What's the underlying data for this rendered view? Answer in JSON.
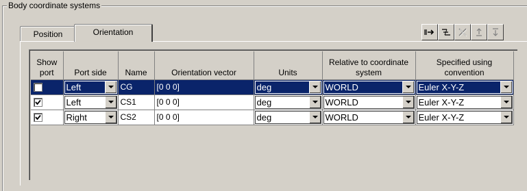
{
  "group": {
    "title": "Body coordinate systems"
  },
  "tabs": [
    {
      "label": "Position",
      "active": false
    },
    {
      "label": "Orientation",
      "active": true
    }
  ],
  "toolbar": {
    "buttons": [
      {
        "name": "add-icon",
        "enabled": true
      },
      {
        "name": "indent-icon",
        "enabled": true
      },
      {
        "name": "delete-icon",
        "enabled": false
      },
      {
        "name": "move-up-icon",
        "enabled": false
      },
      {
        "name": "move-down-icon",
        "enabled": false
      }
    ]
  },
  "table": {
    "headers": {
      "show_port": "Show port",
      "port_side": "Port side",
      "name": "Name",
      "orientation_vector": "Orientation vector",
      "units": "Units",
      "relative_to": "Relative to coordinate system",
      "specified_using": "Specified using convention"
    },
    "rows": [
      {
        "show_port": false,
        "port_side": "Left",
        "name": "CG",
        "orientation_vector": "[0 0 0]",
        "units": "deg",
        "relative_to": "WORLD",
        "specified_using": "Euler X-Y-Z",
        "selected": true
      },
      {
        "show_port": true,
        "port_side": "Left",
        "name": "CS1",
        "orientation_vector": "[0 0 0]",
        "units": "deg",
        "relative_to": "WORLD",
        "specified_using": "Euler X-Y-Z",
        "selected": false
      },
      {
        "show_port": true,
        "port_side": "Right",
        "name": "CS2",
        "orientation_vector": "[0 0 0]",
        "units": "deg",
        "relative_to": "WORLD",
        "specified_using": "Euler X-Y-Z",
        "selected": false
      }
    ]
  },
  "colors": {
    "selection": "#0a246a",
    "face": "#d4d0c8"
  }
}
